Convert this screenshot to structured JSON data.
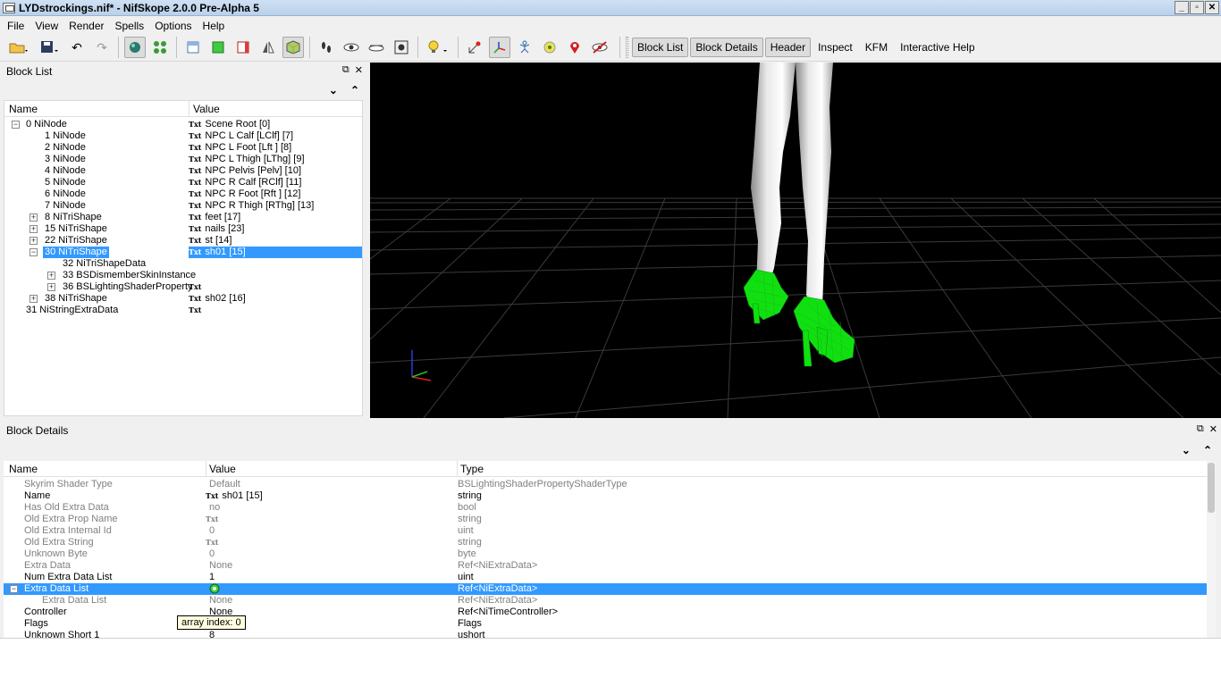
{
  "window": {
    "title": "LYDstrockings.nif* - NifSkope 2.0.0 Pre-Alpha 5"
  },
  "menu": [
    "File",
    "View",
    "Render",
    "Spells",
    "Options",
    "Help"
  ],
  "toolbar_tabs": [
    "Block List",
    "Block Details",
    "Header",
    "Inspect",
    "KFM",
    "Interactive Help"
  ],
  "blocklist": {
    "title": "Block List",
    "columns": {
      "name": "Name",
      "value": "Value"
    },
    "rows": [
      {
        "name": "0 NiNode",
        "value": "Scene Root [0]"
      },
      {
        "name": "1 NiNode",
        "value": "NPC L Calf [LClf] [7]"
      },
      {
        "name": "2 NiNode",
        "value": "NPC L Foot [Lft ] [8]"
      },
      {
        "name": "3 NiNode",
        "value": "NPC L Thigh [LThg] [9]"
      },
      {
        "name": "4 NiNode",
        "value": "NPC Pelvis [Pelv] [10]"
      },
      {
        "name": "5 NiNode",
        "value": "NPC R Calf [RClf] [11]"
      },
      {
        "name": "6 NiNode",
        "value": "NPC R Foot [Rft ] [12]"
      },
      {
        "name": "7 NiNode",
        "value": "NPC R Thigh [RThg] [13]"
      },
      {
        "name": "8 NiTriShape",
        "value": "feet [17]"
      },
      {
        "name": "15 NiTriShape",
        "value": "nails [23]"
      },
      {
        "name": "22 NiTriShape",
        "value": "st [14]"
      },
      {
        "name": "30 NiTriShape",
        "value": "sh01 [15]"
      },
      {
        "name": "32 NiTriShapeData",
        "value": ""
      },
      {
        "name": "33 BSDismemberSkinInstance",
        "value": ""
      },
      {
        "name": "36 BSLightingShaderProperty",
        "value": ""
      },
      {
        "name": "38 NiTriShape",
        "value": "sh02 [16]"
      },
      {
        "name": "31 NiStringExtraData",
        "value": ""
      }
    ]
  },
  "details": {
    "title": "Block Details",
    "columns": {
      "name": "Name",
      "value": "Value",
      "type": "Type"
    },
    "rows": [
      {
        "name": "Skyrim Shader Type",
        "value": "Default",
        "type": "BSLightingShaderPropertyShaderType"
      },
      {
        "name": "Name",
        "value": "sh01 [15]",
        "type": "string"
      },
      {
        "name": "Has Old Extra Data",
        "value": "no",
        "type": "bool"
      },
      {
        "name": "Old Extra Prop Name",
        "value": "",
        "type": "string"
      },
      {
        "name": "Old Extra Internal Id",
        "value": "0",
        "type": "uint"
      },
      {
        "name": "Old Extra String",
        "value": "",
        "type": "string"
      },
      {
        "name": "Unknown Byte",
        "value": "0",
        "type": "byte"
      },
      {
        "name": "Extra Data",
        "value": "None",
        "type": "Ref<NiExtraData>"
      },
      {
        "name": "Num Extra Data List",
        "value": "1",
        "type": "uint"
      },
      {
        "name": "Extra Data List",
        "value": "",
        "type": "Ref<NiExtraData>"
      },
      {
        "name": "Extra Data List",
        "value": "None",
        "type": "Ref<NiExtraData>"
      },
      {
        "name": "Controller",
        "value": "None",
        "type": "Ref<NiTimeController>"
      },
      {
        "name": "Flags",
        "value": "",
        "type": "Flags"
      },
      {
        "name": "Unknown Short 1",
        "value": "8",
        "type": "ushort"
      }
    ],
    "tooltip": "array index: 0"
  },
  "txt_marker": "Txt",
  "colors": {
    "selection": "#3399ff",
    "mesh_highlight": "#00ff00",
    "viewport_bg": "#000000"
  }
}
